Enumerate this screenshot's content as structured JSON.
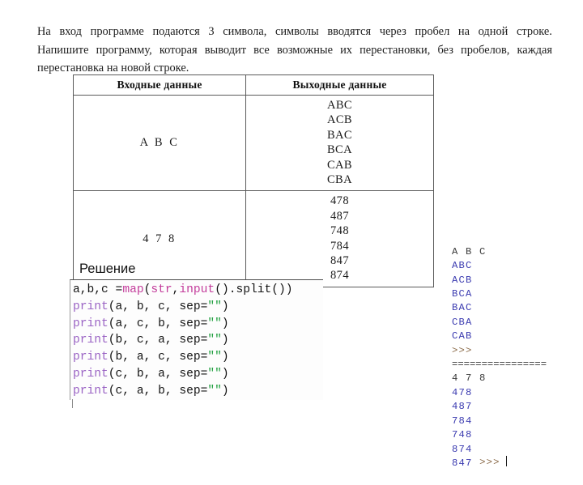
{
  "task": {
    "lines": [
      "На вход программе подаются 3 символа, символы вводятся через пробел на одной строке.",
      "Напишите программу, которая выводит все возможные их перестановки, без пробелов, каждая",
      "перестановка на новой строке."
    ],
    "line1_words": [
      "На",
      "вход",
      "программе",
      "подаются",
      "3",
      "символа,",
      "символы",
      "вводятся",
      "через",
      "пробел",
      "на",
      "одной",
      "строке."
    ],
    "line2_words": [
      "Напишите",
      "программу,",
      "которая",
      "выводит",
      "все",
      "возможные",
      "их",
      "перестановки,",
      "без",
      "пробелов,",
      "каждая"
    ],
    "line3": "перестановка на новой строке."
  },
  "table": {
    "headers": [
      "Входные данные",
      "Выходные данные"
    ],
    "rows": [
      {
        "input": "A B C",
        "output": [
          "ABC",
          "ACB",
          "BAC",
          "BCA",
          "CAB",
          "CBA"
        ]
      },
      {
        "input": "4 7 8",
        "output": [
          "478",
          "487",
          "748",
          "784",
          "847",
          "874"
        ]
      }
    ]
  },
  "solution": {
    "heading": "Решение",
    "code_lines": [
      {
        "segments": [
          {
            "text": "a,b,c =",
            "type": "plain"
          },
          {
            "text": "map",
            "type": "builtin"
          },
          {
            "text": "(",
            "type": "plain"
          },
          {
            "text": "str",
            "type": "builtin"
          },
          {
            "text": ",",
            "type": "plain"
          },
          {
            "text": "input",
            "type": "builtin"
          },
          {
            "text": "().split())",
            "type": "plain"
          }
        ]
      },
      {
        "segments": [
          {
            "text": "print",
            "type": "keyword"
          },
          {
            "text": "(a, b, c, sep=",
            "type": "plain"
          },
          {
            "text": "\"\"",
            "type": "string"
          },
          {
            "text": ")",
            "type": "plain"
          }
        ]
      },
      {
        "segments": [
          {
            "text": "print",
            "type": "keyword"
          },
          {
            "text": "(a, c, b, sep=",
            "type": "plain"
          },
          {
            "text": "\"\"",
            "type": "string"
          },
          {
            "text": ")",
            "type": "plain"
          }
        ]
      },
      {
        "segments": [
          {
            "text": "print",
            "type": "keyword"
          },
          {
            "text": "(b, c, a, sep=",
            "type": "plain"
          },
          {
            "text": "\"\"",
            "type": "string"
          },
          {
            "text": ")",
            "type": "plain"
          }
        ]
      },
      {
        "segments": [
          {
            "text": "print",
            "type": "keyword"
          },
          {
            "text": "(b, a, c, sep=",
            "type": "plain"
          },
          {
            "text": "\"\"",
            "type": "string"
          },
          {
            "text": ")",
            "type": "plain"
          }
        ]
      },
      {
        "segments": [
          {
            "text": "print",
            "type": "keyword"
          },
          {
            "text": "(c, b, a, sep=",
            "type": "plain"
          },
          {
            "text": "\"\"",
            "type": "string"
          },
          {
            "text": ")",
            "type": "plain"
          }
        ]
      },
      {
        "segments": [
          {
            "text": "print",
            "type": "keyword"
          },
          {
            "text": "(c, a, b, sep=",
            "type": "plain"
          },
          {
            "text": "\"\"",
            "type": "string"
          },
          {
            "text": ")",
            "type": "plain"
          }
        ]
      }
    ]
  },
  "shell": {
    "lines": [
      {
        "text": "A B C",
        "type": "echo"
      },
      {
        "text": "ABC",
        "type": "result"
      },
      {
        "text": "ACB",
        "type": "result"
      },
      {
        "text": "BCA",
        "type": "result"
      },
      {
        "text": "BAC",
        "type": "result"
      },
      {
        "text": "CBA",
        "type": "result"
      },
      {
        "text": "CAB",
        "type": "result"
      },
      {
        "text": ">>>",
        "type": "prompt"
      },
      {
        "text": "================",
        "type": "rule"
      },
      {
        "text": "4 7 8",
        "type": "echo"
      },
      {
        "text": "478",
        "type": "result"
      },
      {
        "text": "487",
        "type": "result"
      },
      {
        "text": "784",
        "type": "result"
      },
      {
        "text": "748",
        "type": "result"
      },
      {
        "text": "874",
        "type": "result"
      },
      {
        "text": "847",
        "type": "result"
      }
    ],
    "final_prompt": ">>>"
  },
  "colors": {
    "builtin": "#c33c9b",
    "keyword": "#9a63c4",
    "string": "#1c9e3c",
    "shell_result": "#3b3bb0",
    "shell_prompt": "#8a6a48",
    "table_border": "#5a5a5a"
  }
}
